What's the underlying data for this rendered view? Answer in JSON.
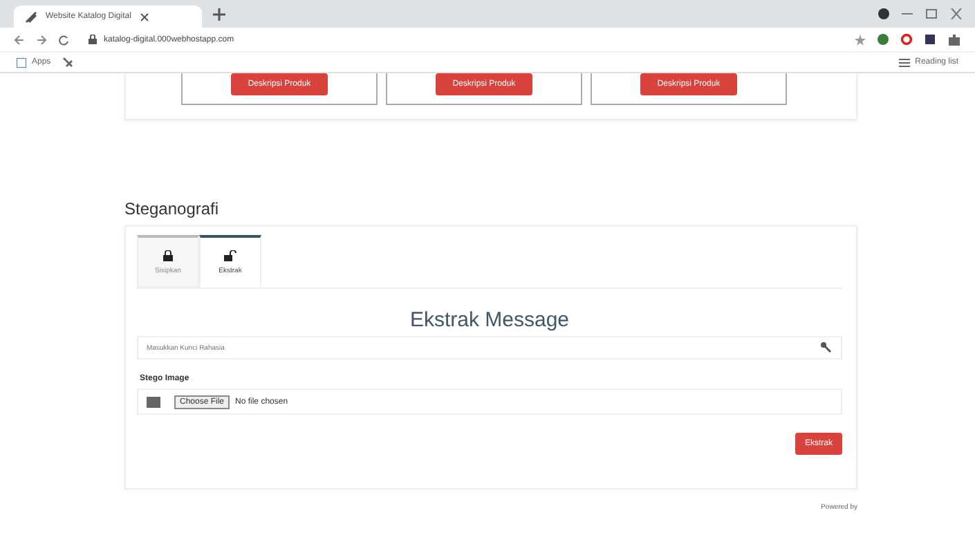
{
  "browser": {
    "tab_title": "Website Katalog Digital",
    "url": "katalog-digital.000webhostapp.com",
    "bookmarks": [
      {
        "label": "Apps"
      }
    ],
    "reading_list": "Reading list"
  },
  "products": [
    {
      "button": "Deskripsi Produk"
    },
    {
      "button": "Deskripsi Produk"
    },
    {
      "button": "Deskripsi Produk"
    }
  ],
  "section_title": "Steganografi",
  "tabs": [
    {
      "label": "Sisipkan",
      "kind": "lock",
      "selected": false
    },
    {
      "label": "Ekstrak",
      "kind": "unlock",
      "selected": true
    }
  ],
  "form": {
    "title": "Ekstrak Message",
    "key_placeholder": "Masukkan Kunci Rahasia",
    "file_label": "Stego Image",
    "file_button": "Choose File",
    "file_status": "No file chosen",
    "submit": "Ekstrak"
  },
  "footer": "Powered by"
}
